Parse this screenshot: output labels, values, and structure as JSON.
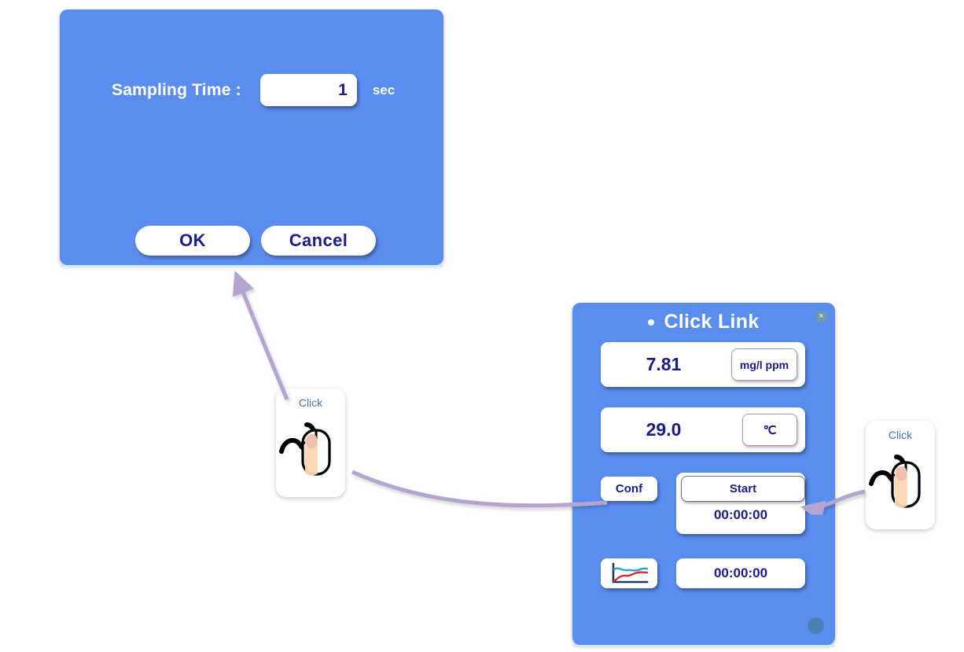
{
  "sampling_dialog": {
    "label": "Sampling Time :",
    "value": "1",
    "placeholder": "1",
    "unit": "sec",
    "ok_label": "OK",
    "cancel_label": "Cancel",
    "panel_color": "#5b8def",
    "text_color": "#ffffff",
    "value_color": "#1b1b8f"
  },
  "click_link_panel": {
    "title": "Click Link",
    "close_glyph": "×",
    "panel_color": "#5b8def",
    "readings": [
      {
        "value": "7.81",
        "unit": "mg/l ppm"
      },
      {
        "value": "29.0",
        "unit": "℃"
      }
    ],
    "conf_label": "Conf",
    "start_label": "Start",
    "start_timer": "00:00:00",
    "elapsed_timer": "00:00:00",
    "graph_icon": "line-chart-icon",
    "graph_icon_colors": {
      "axis": "#1b3a6b",
      "upper_line": "#2f9fd0",
      "lower_line": "#d42a2a"
    },
    "resize_handle": "resize-dot"
  },
  "click_cards": [
    {
      "label": "Click",
      "icon": "mouse-click-icon"
    },
    {
      "label": "Click",
      "icon": "mouse-click-icon"
    }
  ],
  "connectors": {
    "color": "#b3a5cf",
    "items": [
      {
        "name": "arrow-to-ok-button",
        "from": "click-card-left",
        "to": "ok-button"
      },
      {
        "name": "arrow-to-conf-button",
        "from": "click-card-left",
        "to": "conf-button"
      },
      {
        "name": "arrow-to-start-button",
        "from": "click-card-right",
        "to": "start-button"
      }
    ]
  }
}
